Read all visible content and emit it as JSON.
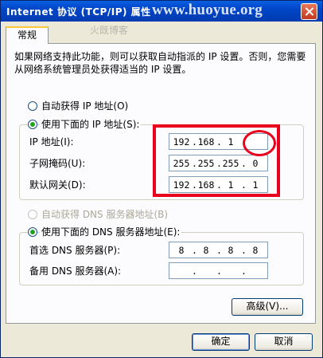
{
  "window": {
    "title": "Internet 协议 (TCP/IP) 属性",
    "watermark": "www.huoyue.org",
    "watermark_cn": "火既博客"
  },
  "tabs": [
    {
      "label": "常规"
    }
  ],
  "description": "如果网络支持此功能，则可以获取自动指派的 IP 设置。否则，您需要从网络系统管理员处获得适当的 IP 设置。",
  "ip": {
    "auto_label": "自动获得 IP 地址(O)",
    "manual_label": "使用下面的 IP 地址(S):",
    "selected": "manual",
    "fields": [
      {
        "label": "IP 地址(I):",
        "octets": [
          "192",
          "168",
          "1",
          ""
        ]
      },
      {
        "label": "子网掩码(U):",
        "octets": [
          "255",
          "255",
          "255",
          "0"
        ]
      },
      {
        "label": "默认网关(D):",
        "octets": [
          "192",
          "168",
          "1",
          "1"
        ]
      }
    ]
  },
  "dns": {
    "auto_label": "自动获得 DNS 服务器地址(B)",
    "manual_label": "使用下面的 DNS 服务器地址(E):",
    "selected": "manual",
    "fields": [
      {
        "label": "首选 DNS 服务器(P):",
        "octets": [
          "8",
          "8",
          "8",
          "8"
        ]
      },
      {
        "label": "备用 DNS 服务器(A):",
        "octets": [
          "",
          "",
          "",
          ""
        ]
      }
    ]
  },
  "buttons": {
    "advanced": "高级(V)...",
    "ok": "确定",
    "cancel": "取消"
  },
  "colors": {
    "titlebar": "#0045c8",
    "highlight": "#e8001c",
    "radio_checked": "#21a121"
  }
}
